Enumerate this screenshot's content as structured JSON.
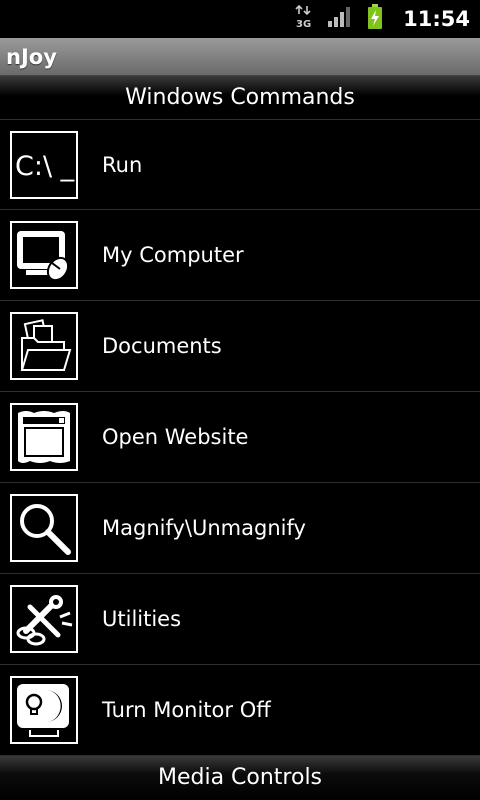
{
  "status_bar": {
    "time": "11:54",
    "network": "3G"
  },
  "title_bar": {
    "title": "nJoy"
  },
  "sections": {
    "top": "Windows Commands",
    "bottom": "Media Controls"
  },
  "commands": [
    {
      "label": "Run",
      "icon": "command-prompt-icon",
      "icon_text": "C:\\ _"
    },
    {
      "label": "My Computer",
      "icon": "my-computer-icon"
    },
    {
      "label": "Documents",
      "icon": "folder-icon"
    },
    {
      "label": "Open Website",
      "icon": "browser-window-icon"
    },
    {
      "label": "Magnify\\Unmagnify",
      "icon": "magnifier-icon"
    },
    {
      "label": "Utilities",
      "icon": "utilities-icon"
    },
    {
      "label": "Turn Monitor Off",
      "icon": "monitor-off-icon"
    }
  ]
}
